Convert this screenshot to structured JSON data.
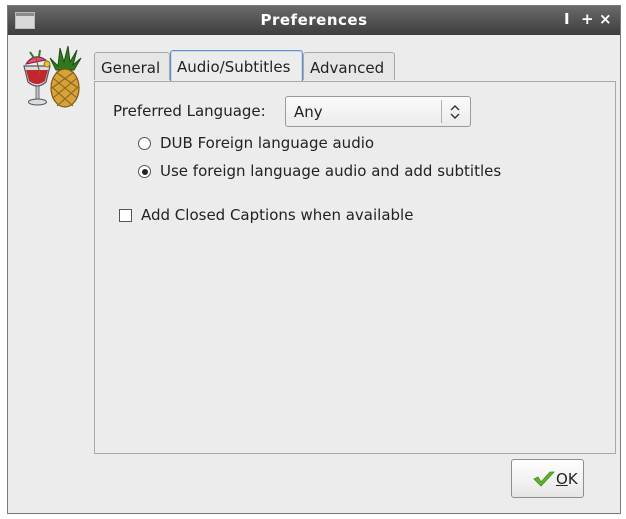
{
  "window": {
    "title": "Preferences",
    "controls": {
      "minimize": "I",
      "maximize": "+",
      "close": "×"
    }
  },
  "tabs": [
    {
      "label": "General",
      "active": false
    },
    {
      "label": "Audio/Subtitles",
      "active": true
    },
    {
      "label": "Advanced",
      "active": false
    }
  ],
  "audio": {
    "preferred_language_label": "Preferred Language:",
    "preferred_language_value": "Any",
    "dropdown_arrow": "◇",
    "options": [
      {
        "label": "DUB Foreign language audio",
        "checked": false
      },
      {
        "label": "Use foreign language audio and add subtitles",
        "checked": true
      }
    ],
    "closed_captions": {
      "label": "Add Closed Captions when available",
      "checked": false
    }
  },
  "buttons": {
    "ok": {
      "mnemonic": "O",
      "rest": "K"
    }
  },
  "icons": {
    "app": "handbrake-icon",
    "ok": "checkmark-icon"
  },
  "colors": {
    "titlebar": "#4a4a4a",
    "window_bg": "#ececec",
    "accent_check": "#5fb62f",
    "active_tab_border": "#6b8fc4"
  }
}
